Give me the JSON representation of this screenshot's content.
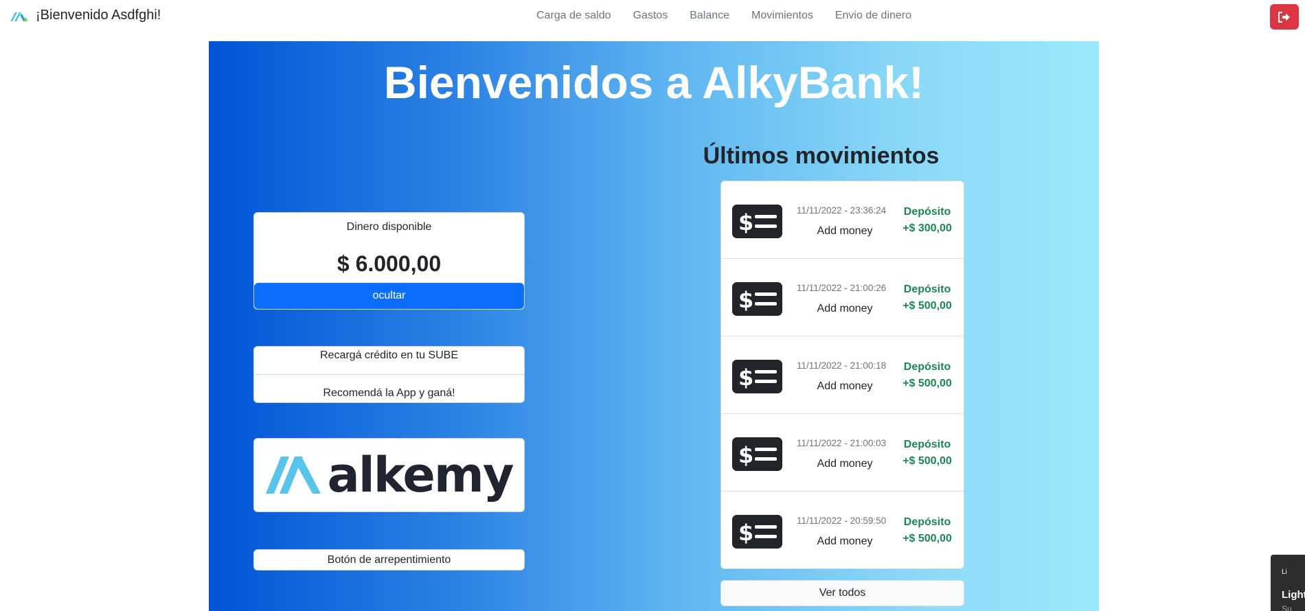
{
  "navbar": {
    "brand_text": "¡Bienvenido Asdfghi!",
    "links": [
      "Carga de saldo",
      "Gastos",
      "Balance",
      "Movimientos",
      "Envio de dinero"
    ]
  },
  "hero": {
    "title": "Bienvenidos a AlkyBank!"
  },
  "balance": {
    "label": "Dinero disponible",
    "amount": "$ 6.000,00",
    "hide_label": "ocultar"
  },
  "links": {
    "sube": "Recargá crédito en tu SUBE",
    "recommend": "Recomendá la App y ganá!"
  },
  "alkemy": {
    "word": "alkemy"
  },
  "regret_button": "Botón de arrepentimiento",
  "movements": {
    "title": "Últimos movimientos",
    "items": [
      {
        "date": "11/11/2022 - 23:36:24",
        "description": "Add money",
        "type": "Depósito",
        "amount": "+$ 300,00"
      },
      {
        "date": "11/11/2022 - 21:00:26",
        "description": "Add money",
        "type": "Depósito",
        "amount": "+$ 500,00"
      },
      {
        "date": "11/11/2022 - 21:00:18",
        "description": "Add money",
        "type": "Depósito",
        "amount": "+$ 500,00"
      },
      {
        "date": "11/11/2022 - 21:00:03",
        "description": "Add money",
        "type": "Depósito",
        "amount": "+$ 500,00"
      },
      {
        "date": "11/11/2022 - 20:59:50",
        "description": "Add money",
        "type": "Depósito",
        "amount": "+$ 500,00"
      }
    ],
    "view_all": "Ver todos"
  },
  "corner_widget": {
    "small": "Li",
    "big": "Light",
    "sub": "Su"
  },
  "colors": {
    "primary": "#0d6efd",
    "danger": "#dc3545",
    "success": "#198754",
    "gradient_start": "#0353d6",
    "gradient_end": "#9be9fa"
  },
  "icons": {
    "brand": "alkemy-mark-icon",
    "logout": "sign-out-icon",
    "movement": "money-bill-icon"
  }
}
